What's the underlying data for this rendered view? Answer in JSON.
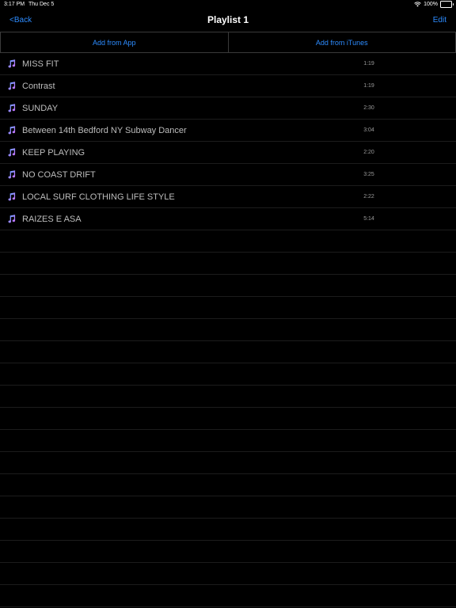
{
  "status": {
    "time": "3:17 PM",
    "date": "Thu Dec 5",
    "battery": "100%",
    "battery_level": 1.0
  },
  "nav": {
    "back_label": "<Back",
    "title": "Playlist 1",
    "edit_label": "Edit"
  },
  "segment": {
    "add_from_app": "Add from App",
    "add_from_itunes": "Add from iTunes"
  },
  "tracks": [
    {
      "title": "MISS FIT",
      "duration": "1:19"
    },
    {
      "title": "Contrast",
      "duration": "1:19"
    },
    {
      "title": "SUNDAY",
      "duration": "2:30"
    },
    {
      "title": "Between 14th Bedford NY Subway Dancer",
      "duration": "3:04"
    },
    {
      "title": "KEEP PLAYING",
      "duration": "2:20"
    },
    {
      "title": "NO COAST DRIFT",
      "duration": "3:25"
    },
    {
      "title": "LOCAL SURF CLOTHING LIFE STYLE",
      "duration": "2:22"
    },
    {
      "title": "RAIZES E ASA",
      "duration": "5:14"
    }
  ],
  "empty_rows": 17,
  "colors": {
    "accent": "#2d8cff",
    "background": "#000000",
    "note_gradient_top": "#5aa9ff",
    "note_gradient_bottom": "#d46bff"
  }
}
